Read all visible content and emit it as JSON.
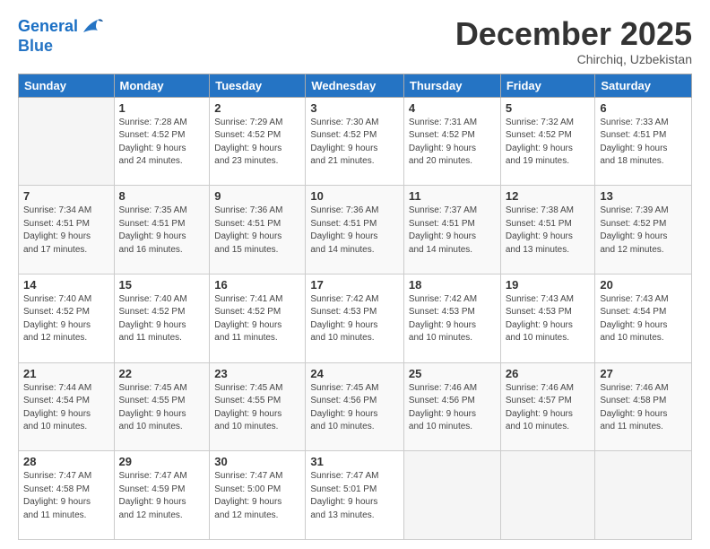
{
  "logo": {
    "line1": "General",
    "line2": "Blue"
  },
  "header": {
    "title": "December 2025",
    "subtitle": "Chirchiq, Uzbekistan"
  },
  "days_of_week": [
    "Sunday",
    "Monday",
    "Tuesday",
    "Wednesday",
    "Thursday",
    "Friday",
    "Saturday"
  ],
  "weeks": [
    [
      {
        "num": "",
        "info": ""
      },
      {
        "num": "1",
        "info": "Sunrise: 7:28 AM\nSunset: 4:52 PM\nDaylight: 9 hours\nand 24 minutes."
      },
      {
        "num": "2",
        "info": "Sunrise: 7:29 AM\nSunset: 4:52 PM\nDaylight: 9 hours\nand 23 minutes."
      },
      {
        "num": "3",
        "info": "Sunrise: 7:30 AM\nSunset: 4:52 PM\nDaylight: 9 hours\nand 21 minutes."
      },
      {
        "num": "4",
        "info": "Sunrise: 7:31 AM\nSunset: 4:52 PM\nDaylight: 9 hours\nand 20 minutes."
      },
      {
        "num": "5",
        "info": "Sunrise: 7:32 AM\nSunset: 4:52 PM\nDaylight: 9 hours\nand 19 minutes."
      },
      {
        "num": "6",
        "info": "Sunrise: 7:33 AM\nSunset: 4:51 PM\nDaylight: 9 hours\nand 18 minutes."
      }
    ],
    [
      {
        "num": "7",
        "info": "Sunrise: 7:34 AM\nSunset: 4:51 PM\nDaylight: 9 hours\nand 17 minutes."
      },
      {
        "num": "8",
        "info": "Sunrise: 7:35 AM\nSunset: 4:51 PM\nDaylight: 9 hours\nand 16 minutes."
      },
      {
        "num": "9",
        "info": "Sunrise: 7:36 AM\nSunset: 4:51 PM\nDaylight: 9 hours\nand 15 minutes."
      },
      {
        "num": "10",
        "info": "Sunrise: 7:36 AM\nSunset: 4:51 PM\nDaylight: 9 hours\nand 14 minutes."
      },
      {
        "num": "11",
        "info": "Sunrise: 7:37 AM\nSunset: 4:51 PM\nDaylight: 9 hours\nand 14 minutes."
      },
      {
        "num": "12",
        "info": "Sunrise: 7:38 AM\nSunset: 4:51 PM\nDaylight: 9 hours\nand 13 minutes."
      },
      {
        "num": "13",
        "info": "Sunrise: 7:39 AM\nSunset: 4:52 PM\nDaylight: 9 hours\nand 12 minutes."
      }
    ],
    [
      {
        "num": "14",
        "info": "Sunrise: 7:40 AM\nSunset: 4:52 PM\nDaylight: 9 hours\nand 12 minutes."
      },
      {
        "num": "15",
        "info": "Sunrise: 7:40 AM\nSunset: 4:52 PM\nDaylight: 9 hours\nand 11 minutes."
      },
      {
        "num": "16",
        "info": "Sunrise: 7:41 AM\nSunset: 4:52 PM\nDaylight: 9 hours\nand 11 minutes."
      },
      {
        "num": "17",
        "info": "Sunrise: 7:42 AM\nSunset: 4:53 PM\nDaylight: 9 hours\nand 10 minutes."
      },
      {
        "num": "18",
        "info": "Sunrise: 7:42 AM\nSunset: 4:53 PM\nDaylight: 9 hours\nand 10 minutes."
      },
      {
        "num": "19",
        "info": "Sunrise: 7:43 AM\nSunset: 4:53 PM\nDaylight: 9 hours\nand 10 minutes."
      },
      {
        "num": "20",
        "info": "Sunrise: 7:43 AM\nSunset: 4:54 PM\nDaylight: 9 hours\nand 10 minutes."
      }
    ],
    [
      {
        "num": "21",
        "info": "Sunrise: 7:44 AM\nSunset: 4:54 PM\nDaylight: 9 hours\nand 10 minutes."
      },
      {
        "num": "22",
        "info": "Sunrise: 7:45 AM\nSunset: 4:55 PM\nDaylight: 9 hours\nand 10 minutes."
      },
      {
        "num": "23",
        "info": "Sunrise: 7:45 AM\nSunset: 4:55 PM\nDaylight: 9 hours\nand 10 minutes."
      },
      {
        "num": "24",
        "info": "Sunrise: 7:45 AM\nSunset: 4:56 PM\nDaylight: 9 hours\nand 10 minutes."
      },
      {
        "num": "25",
        "info": "Sunrise: 7:46 AM\nSunset: 4:56 PM\nDaylight: 9 hours\nand 10 minutes."
      },
      {
        "num": "26",
        "info": "Sunrise: 7:46 AM\nSunset: 4:57 PM\nDaylight: 9 hours\nand 10 minutes."
      },
      {
        "num": "27",
        "info": "Sunrise: 7:46 AM\nSunset: 4:58 PM\nDaylight: 9 hours\nand 11 minutes."
      }
    ],
    [
      {
        "num": "28",
        "info": "Sunrise: 7:47 AM\nSunset: 4:58 PM\nDaylight: 9 hours\nand 11 minutes."
      },
      {
        "num": "29",
        "info": "Sunrise: 7:47 AM\nSunset: 4:59 PM\nDaylight: 9 hours\nand 12 minutes."
      },
      {
        "num": "30",
        "info": "Sunrise: 7:47 AM\nSunset: 5:00 PM\nDaylight: 9 hours\nand 12 minutes."
      },
      {
        "num": "31",
        "info": "Sunrise: 7:47 AM\nSunset: 5:01 PM\nDaylight: 9 hours\nand 13 minutes."
      },
      {
        "num": "",
        "info": ""
      },
      {
        "num": "",
        "info": ""
      },
      {
        "num": "",
        "info": ""
      }
    ]
  ]
}
